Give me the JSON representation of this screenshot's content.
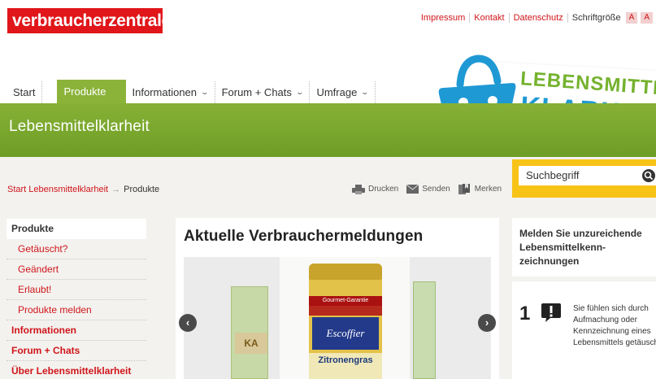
{
  "header": {
    "logo_text": "verbraucherzentrale",
    "links": [
      "Impressum",
      "Kontakt",
      "Datenschutz"
    ],
    "font_size_label": "Schriftgröße",
    "font_size_buttons": [
      "A",
      "A"
    ]
  },
  "nav": {
    "items": [
      {
        "label": "Start",
        "dropdown": false
      },
      {
        "label": "Produkte",
        "dropdown": false,
        "active": true
      },
      {
        "label": "Informationen",
        "dropdown": true
      },
      {
        "label": "Forum + Chats",
        "dropdown": true
      },
      {
        "label": "Umfrage",
        "dropdown": true
      }
    ]
  },
  "banner": {
    "title": "Lebensmittelklarheit",
    "brand_line1": "LEBENSMITTEL",
    "brand_line2": "KLARHEIT"
  },
  "breadcrumb": {
    "items": [
      "Start Lebensmittelklarheit",
      "Produkte"
    ],
    "separator": "→"
  },
  "tools": {
    "print": "Drucken",
    "send": "Senden",
    "bookmark": "Merken"
  },
  "search": {
    "placeholder": "Suchbegriff"
  },
  "sidebar": {
    "heading": "Produkte",
    "subitems": [
      "Getäuscht?",
      "Geändert",
      "Erlaubt!",
      "Produkte melden"
    ],
    "main_items": [
      "Informationen",
      "Forum + Chats",
      "Über Lebensmittelklarheit"
    ]
  },
  "main": {
    "title": "Aktuelle Verbrauchermeldungen",
    "carousel": {
      "prev": "‹",
      "next": "›",
      "pack_label": "KA",
      "jar_gourmet": "Gourmet-Garantie",
      "jar_brand": "Escoffier",
      "jar_name": "Zitronengras"
    }
  },
  "report": {
    "title": "Melden Sie unzureichende Lebensmittelkenn-zeichnungen",
    "step_number": "1",
    "step_text": "Sie fühlen sich durch Aufmachung oder Kennzeichnung eines Lebensmittels getäuscht?"
  },
  "colors": {
    "brand_red": "#e0161a",
    "nav_green": "#8bb33a",
    "search_yellow": "#f7c317",
    "lk_blue": "#1f99d4"
  }
}
